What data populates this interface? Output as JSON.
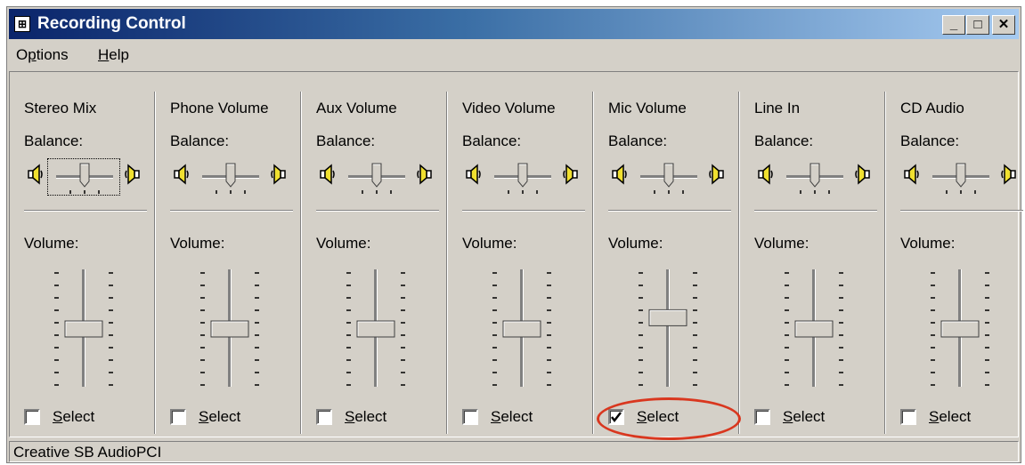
{
  "window": {
    "title": "Recording Control",
    "app_icon": "mixer-icon"
  },
  "title_buttons": {
    "minimize": "_",
    "maximize": "□",
    "close": "✕"
  },
  "menu": [
    {
      "pre": "O",
      "ul": "p",
      "post": "tions"
    },
    {
      "pre": "",
      "ul": "H",
      "post": "elp"
    }
  ],
  "labels": {
    "balance": "Balance:",
    "volume": "Volume:",
    "select_ul": "S",
    "select_rest": "elect"
  },
  "channels": [
    {
      "name": "Stereo Mix",
      "selected": false,
      "focused": true,
      "balance": 0,
      "volume": 0.5
    },
    {
      "name": "Phone Volume",
      "selected": false,
      "focused": false,
      "balance": 0,
      "volume": 0.5
    },
    {
      "name": "Aux Volume",
      "selected": false,
      "focused": false,
      "balance": 0,
      "volume": 0.5
    },
    {
      "name": "Video Volume",
      "selected": false,
      "focused": false,
      "balance": 0,
      "volume": 0.5
    },
    {
      "name": "Mic Volume",
      "selected": true,
      "focused": false,
      "balance": 0,
      "volume": 0.6
    },
    {
      "name": "Line In",
      "selected": false,
      "focused": false,
      "balance": 0,
      "volume": 0.5
    },
    {
      "name": "CD Audio",
      "selected": false,
      "focused": false,
      "balance": 0,
      "volume": 0.5
    }
  ],
  "status": {
    "device": "Creative SB AudioPCI"
  },
  "colors": {
    "title_start": "#0a246a",
    "title_end": "#a6caf0",
    "face": "#d4d0c8",
    "highlight_ring": "#d9371f"
  }
}
